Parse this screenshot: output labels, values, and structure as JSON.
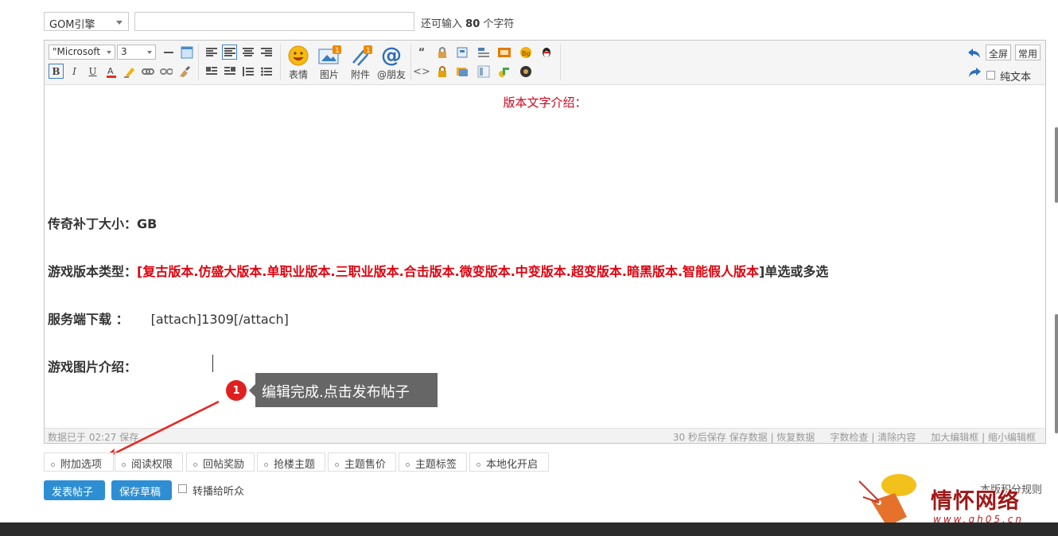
{
  "top": {
    "type_select": "GOM引擎",
    "title_value": "",
    "char_hint_prefix": "还可输入",
    "char_hint_count": "80",
    "char_hint_suffix": "个字符"
  },
  "toolbar": {
    "font": "\"Microsoft",
    "size": "3",
    "emoji_label": "表情",
    "image_label": "图片",
    "attach_label": "附件",
    "mention_label": "@朋友",
    "fullscreen": "全屏",
    "common": "常用",
    "plain_text": "纯文本",
    "badge_image": "1",
    "badge_attach": "1"
  },
  "content": {
    "heading": "版本文字介绍：",
    "patch_size_label": "传奇补丁大小：",
    "patch_size_value": "GB",
    "type_label": "游戏版本类型：",
    "type_open": "[",
    "type_values": "复古版本.仿盛大版本.单职业版本.三职业版本.合击版本.微变版本.中变版本.超变版本.暗黑版本.智能假人版本",
    "type_close": "]单选或多选",
    "server_label": "服务端下载 ：",
    "server_value": "[attach]1309[/attach]",
    "image_label": "游戏图片介绍："
  },
  "status": {
    "left": "数据已于 02:27 保存",
    "autosave": "30 秒后保存",
    "save_data": "保存数据",
    "restore": "恢复数据",
    "word_check": "字数检查",
    "clear": "清除内容",
    "enlarge": "加大编辑框",
    "shrink": "缩小编辑框"
  },
  "tooltip": {
    "badge": "1",
    "text": "编辑完成.点击发布帖子"
  },
  "options": [
    {
      "label": "附加选项"
    },
    {
      "label": "阅读权限"
    },
    {
      "label": "回帖奖励"
    },
    {
      "label": "抢楼主题"
    },
    {
      "label": "主题售价"
    },
    {
      "label": "主题标签"
    },
    {
      "label": "本地化开启"
    }
  ],
  "actions": {
    "publish": "发表帖子",
    "save_draft": "保存草稿",
    "broadcast": "转播给听众",
    "rules": "本版积分规则"
  },
  "logo": {
    "text": "情怀网络",
    "url": "www.qh05.cn"
  },
  "colors": {
    "accent_blue": "#2e8ed3",
    "red_text": "#e0000d",
    "tooltip_bg": "#666666",
    "badge_red": "#e02020"
  }
}
